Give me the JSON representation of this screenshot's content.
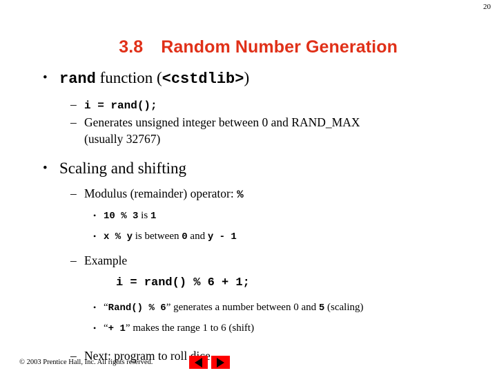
{
  "slide": {
    "page_number": "20",
    "title_number": "3.8",
    "title_text": "Random Number Generation",
    "title_color": "#E03018"
  },
  "content": {
    "b1": {
      "code": "rand",
      "text_mid": " function (",
      "code2": "<cstdlib>",
      "text_end": ")"
    },
    "b1s1": {
      "code": "i = rand();"
    },
    "b1s2": {
      "line1": "Generates unsigned integer between 0 and RAND_MAX",
      "line2": "(usually 32767)"
    },
    "b2": {
      "text": "Scaling and shifting"
    },
    "b2s1": {
      "text": "Modulus (remainder) operator: ",
      "code": "%"
    },
    "b2s1a": {
      "code1": "10 % 3",
      "text1": " is ",
      "code2": "1"
    },
    "b2s1b": {
      "code1": "x % y",
      "text1": " is between ",
      "code2": "0",
      "text2": " and ",
      "code3": "y - 1"
    },
    "b2s2": {
      "text": "Example"
    },
    "b2s2code": {
      "code": "i = rand() % 6 + 1;"
    },
    "b2s2a": {
      "q1": "“",
      "code1": "Rand() % 6",
      "q2": "”",
      "text1": " generates a number between 0 and ",
      "code2": "5",
      "text2": " (scaling)"
    },
    "b2s2b": {
      "q1": "“",
      "code1": "+ 1",
      "q2": "”",
      "text1": " makes the range 1 to 6 (shift)"
    },
    "b2s3": {
      "text": "Next: program to roll dice"
    }
  },
  "footer": {
    "copyright": "© 2003 Prentice Hall, Inc.  All rights reserved.",
    "prev_label": "Previous slide",
    "next_label": "Next slide",
    "button_color": "#FE0000"
  },
  "glyphs": {
    "bullet": "•",
    "dash": "–"
  }
}
